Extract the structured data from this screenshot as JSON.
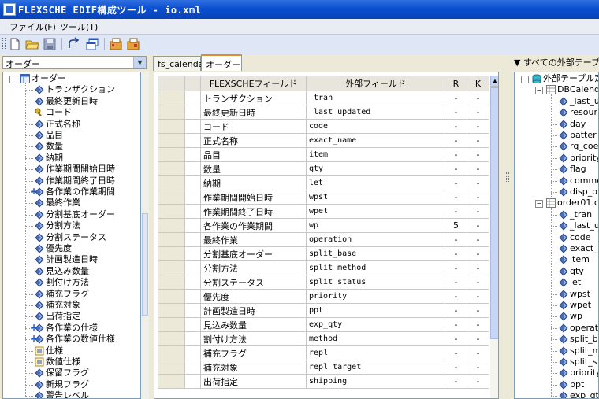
{
  "window": {
    "title": "FLEXSCHE EDIF構成ツール - io.xml"
  },
  "menu": [
    {
      "label": "ファイル(F)"
    },
    {
      "label": "ツール(T)"
    }
  ],
  "toolbar": {
    "buttons": [
      {
        "icon": "new-file-icon"
      },
      {
        "icon": "open-folder-icon"
      },
      {
        "icon": "save-disk-icon"
      },
      {
        "icon": "undo-arrow-icon"
      },
      {
        "icon": "windows-icon"
      },
      {
        "icon": "database-add-icon"
      },
      {
        "icon": "database-settings-icon"
      }
    ]
  },
  "left_panel": {
    "selector_value": "オーダー",
    "tree_root": "オーダー",
    "items": [
      {
        "label": "トランザクション",
        "icon": "field-icon"
      },
      {
        "label": "最終更新日時",
        "icon": "field-icon"
      },
      {
        "label": "コード",
        "icon": "key-icon"
      },
      {
        "label": "正式名称",
        "icon": "field-icon"
      },
      {
        "label": "品目",
        "icon": "field-icon"
      },
      {
        "label": "数量",
        "icon": "field-icon"
      },
      {
        "label": "納期",
        "icon": "field-icon"
      },
      {
        "label": "作業期間開始日時",
        "icon": "field-icon"
      },
      {
        "label": "作業期間終了日時",
        "icon": "field-icon"
      },
      {
        "label": "各作業の作業期間",
        "icon": "field-plus-icon"
      },
      {
        "label": "最終作業",
        "icon": "field-icon"
      },
      {
        "label": "分割基底オーダー",
        "icon": "field-icon"
      },
      {
        "label": "分割方法",
        "icon": "field-icon"
      },
      {
        "label": "分割ステータス",
        "icon": "field-icon"
      },
      {
        "label": "優先度",
        "icon": "field-icon"
      },
      {
        "label": "計画製造日時",
        "icon": "field-icon"
      },
      {
        "label": "見込み数量",
        "icon": "field-icon"
      },
      {
        "label": "割付け方法",
        "icon": "field-icon"
      },
      {
        "label": "補充フラグ",
        "icon": "field-icon"
      },
      {
        "label": "補充対象",
        "icon": "field-icon"
      },
      {
        "label": "出荷指定",
        "icon": "field-icon"
      },
      {
        "label": "各作業の仕様",
        "icon": "field-plus-icon"
      },
      {
        "label": "各作業の数値仕様",
        "icon": "field-plus-icon"
      },
      {
        "label": "仕様",
        "icon": "list-icon"
      },
      {
        "label": "数値仕様",
        "icon": "list-icon"
      },
      {
        "label": "保留フラグ",
        "icon": "field-icon"
      },
      {
        "label": "新規フラグ",
        "icon": "field-icon"
      },
      {
        "label": "警告レベル",
        "icon": "field-icon"
      }
    ]
  },
  "tabs": [
    {
      "label": "fs_calendar"
    },
    {
      "label": "オーダー",
      "active": true
    }
  ],
  "grid": {
    "headers": {
      "flexsche": "FLEXSCHEフィールド",
      "external": "外部フィールド",
      "r": "R",
      "k": "K"
    },
    "rows": [
      {
        "flexsche": "トランザクション",
        "external": "_tran",
        "r": "-",
        "k": "-"
      },
      {
        "flexsche": "最終更新日時",
        "external": "_last_updated",
        "r": "-",
        "k": "-"
      },
      {
        "flexsche": "コード",
        "external": "code",
        "r": "-",
        "k": "-"
      },
      {
        "flexsche": "正式名称",
        "external": "exact_name",
        "r": "-",
        "k": "-"
      },
      {
        "flexsche": "品目",
        "external": "item",
        "r": "-",
        "k": "-"
      },
      {
        "flexsche": "数量",
        "external": "qty",
        "r": "-",
        "k": "-"
      },
      {
        "flexsche": "納期",
        "external": "let",
        "r": "-",
        "k": "-"
      },
      {
        "flexsche": "作業期間開始日時",
        "external": "wpst",
        "r": "-",
        "k": "-"
      },
      {
        "flexsche": "作業期間終了日時",
        "external": "wpet",
        "r": "-",
        "k": "-"
      },
      {
        "flexsche": "各作業の作業期間",
        "external": "wp",
        "r": "5",
        "k": "-"
      },
      {
        "flexsche": "最終作業",
        "external": "operation",
        "r": "-",
        "k": "-"
      },
      {
        "flexsche": "分割基底オーダー",
        "external": "split_base",
        "r": "-",
        "k": "-"
      },
      {
        "flexsche": "分割方法",
        "external": "split_method",
        "r": "-",
        "k": "-"
      },
      {
        "flexsche": "分割ステータス",
        "external": "split_status",
        "r": "-",
        "k": "-"
      },
      {
        "flexsche": "優先度",
        "external": "priority",
        "r": "-",
        "k": "-"
      },
      {
        "flexsche": "計画製造日時",
        "external": "ppt",
        "r": "-",
        "k": "-"
      },
      {
        "flexsche": "見込み数量",
        "external": "exp_qty",
        "r": "-",
        "k": "-"
      },
      {
        "flexsche": "割付け方法",
        "external": "method",
        "r": "-",
        "k": "-"
      },
      {
        "flexsche": "補充フラグ",
        "external": "repl",
        "r": "-",
        "k": "-"
      },
      {
        "flexsche": "補充対象",
        "external": "repl_target",
        "r": "-",
        "k": "-"
      },
      {
        "flexsche": "出荷指定",
        "external": "shipping",
        "r": "-",
        "k": "-"
      }
    ]
  },
  "right_panel": {
    "header": "▼ すべての外部テーブル",
    "root": "外部テーブル定",
    "groups": [
      {
        "label": "DBCalend",
        "fields": [
          "_last_u",
          "resour",
          "day",
          "patter",
          "rq_coe",
          "priority",
          "flag",
          "comme",
          "disp_or"
        ]
      },
      {
        "label": "order01.cs",
        "fields": [
          "_tran",
          "_last_u",
          "code",
          "exact_",
          "item",
          "qty",
          "let",
          "wpst",
          "wpet",
          "wp",
          "operat",
          "split_b",
          "split_m",
          "split_s",
          "priority",
          "ppt",
          "exp_qt"
        ]
      }
    ]
  }
}
